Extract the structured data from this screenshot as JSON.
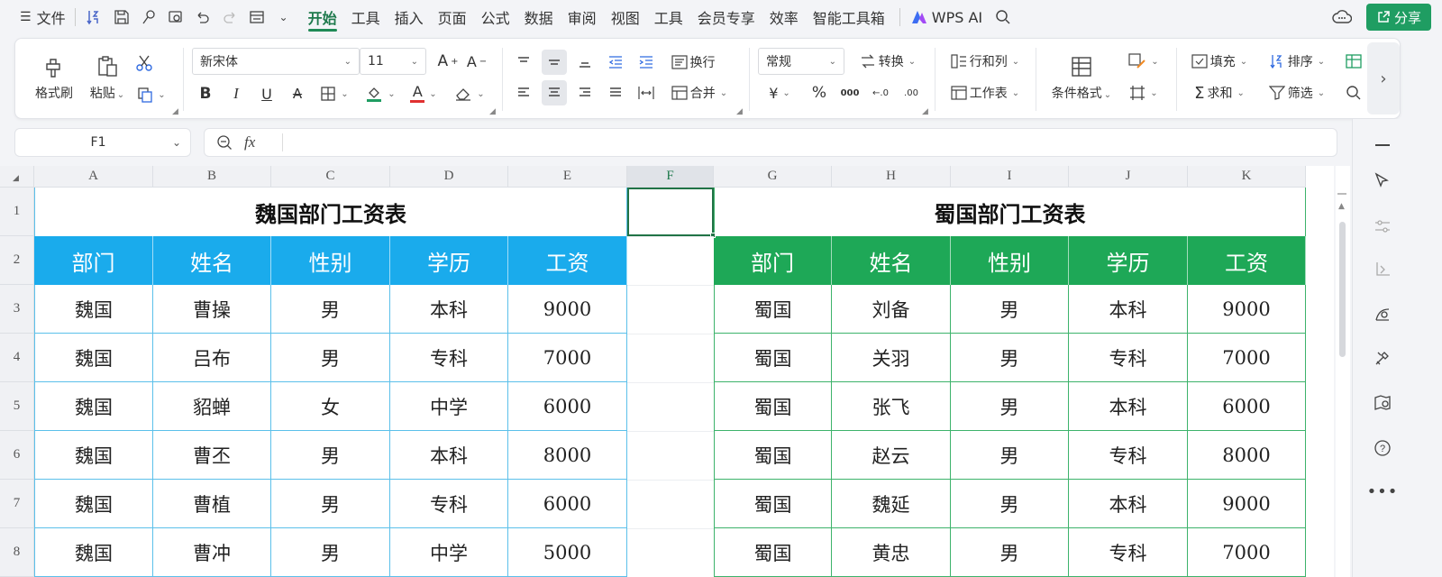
{
  "menu": {
    "file": "文件",
    "tabs": [
      "开始",
      "工具",
      "插入",
      "页面",
      "公式",
      "数据",
      "审阅",
      "视图",
      "工具",
      "会员专享",
      "效率",
      "智能工具箱"
    ],
    "active_tab": "开始",
    "wps_ai": "WPS AI",
    "share": "分享"
  },
  "ribbon": {
    "format_painter": "格式刷",
    "paste": "粘贴",
    "font_name": "新宋体",
    "font_size": "11",
    "wrap": "换行",
    "merge": "合并",
    "number_format": "常规",
    "convert": "转换",
    "rows_cols": "行和列",
    "worksheet": "工作表",
    "cond_format": "条件格式",
    "fill": "填充",
    "sort": "排序",
    "sum": "求和",
    "filter": "筛选",
    "bold": "B",
    "italic": "I",
    "underline": "U",
    "font_color_letter": "A",
    "currency": "¥",
    "percent": "%"
  },
  "formula_bar": {
    "cell_ref": "F1",
    "fx": "fx",
    "value": ""
  },
  "columns": [
    "A",
    "B",
    "C",
    "D",
    "E",
    "F",
    "G",
    "H",
    "I",
    "J",
    "K"
  ],
  "selected_column": "F",
  "rows": [
    "1",
    "2",
    "3",
    "4",
    "5",
    "6",
    "7",
    "8"
  ],
  "wei_table": {
    "title": "魏国部门工资表",
    "header_color": "#1aabec",
    "border_color": "#5bc0ea",
    "headers": [
      "部门",
      "姓名",
      "性别",
      "学历",
      "工资"
    ],
    "rows": [
      [
        "魏国",
        "曹操",
        "男",
        "本科",
        "9000"
      ],
      [
        "魏国",
        "吕布",
        "男",
        "专科",
        "7000"
      ],
      [
        "魏国",
        "貂蝉",
        "女",
        "中学",
        "6000"
      ],
      [
        "魏国",
        "曹丕",
        "男",
        "本科",
        "8000"
      ],
      [
        "魏国",
        "曹植",
        "男",
        "专科",
        "6000"
      ],
      [
        "魏国",
        "曹冲",
        "男",
        "中学",
        "5000"
      ]
    ]
  },
  "shu_table": {
    "title": "蜀国部门工资表",
    "header_color": "#1ea857",
    "border_color": "#3db36b",
    "headers": [
      "部门",
      "姓名",
      "性别",
      "学历",
      "工资"
    ],
    "rows": [
      [
        "蜀国",
        "刘备",
        "男",
        "本科",
        "9000"
      ],
      [
        "蜀国",
        "关羽",
        "男",
        "专科",
        "7000"
      ],
      [
        "蜀国",
        "张飞",
        "男",
        "本科",
        "6000"
      ],
      [
        "蜀国",
        "赵云",
        "男",
        "专科",
        "8000"
      ],
      [
        "蜀国",
        "魏延",
        "男",
        "本科",
        "9000"
      ],
      [
        "蜀国",
        "黄忠",
        "男",
        "专科",
        "7000"
      ]
    ]
  },
  "accent": "#1f9d62"
}
